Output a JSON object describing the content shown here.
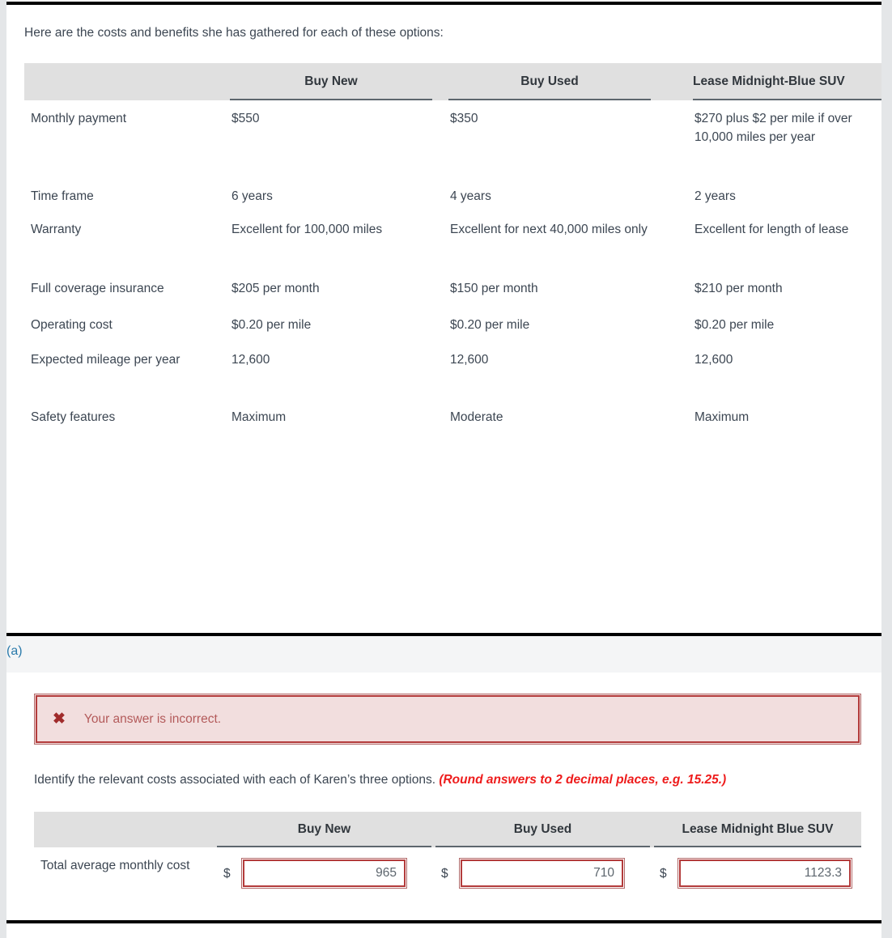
{
  "intro_text": "Here are the costs and benefits she has gathered for each of these options:",
  "comparison_table": {
    "columns": [
      "",
      "Buy New",
      "Buy Used",
      "Lease Midnight-Blue SUV"
    ],
    "rows": [
      {
        "label": "Monthly payment",
        "buy_new": "$550",
        "buy_used": "$350",
        "lease": "$270 plus $2 per mile if over\n10,000 miles per year"
      },
      {
        "label": "Time frame",
        "buy_new": "6 years",
        "buy_used": "4 years",
        "lease": "2 years"
      },
      {
        "label": "Warranty",
        "buy_new": "Excellent for 100,000 miles",
        "buy_used": "Excellent for next 40,000 miles only",
        "lease": "Excellent for length of lease"
      },
      {
        "label": "Full coverage insurance",
        "buy_new": "$205 per month",
        "buy_used": "$150 per month",
        "lease": "$210 per month"
      },
      {
        "label": "Operating cost",
        "buy_new": "$0.20 per mile",
        "buy_used": "$0.20 per mile",
        "lease": "$0.20 per mile"
      },
      {
        "label": "Expected mileage per year",
        "buy_new": "12,600",
        "buy_used": "12,600",
        "lease": "12,600"
      },
      {
        "label": "Safety features",
        "buy_new": "Maximum",
        "buy_used": "Moderate",
        "lease": "Maximum"
      }
    ]
  },
  "part": {
    "label": "(a)",
    "label_color": "#2a7aab"
  },
  "alert": {
    "icon": "x-mark-icon",
    "message": "Your answer is incorrect.",
    "background_color": "#f2dede",
    "border_color": "#b33b3b",
    "text_color": "#b35a5a"
  },
  "requirement": {
    "text": "Identify the relevant costs associated with each of Karen’s three options.",
    "hint": "(Round answers to 2 decimal places, e.g. 15.25.)",
    "hint_color": "#ee1c1c"
  },
  "answer_table": {
    "columns": [
      "",
      "Buy New",
      "Buy Used",
      "Lease Midnight Blue SUV"
    ],
    "row_label": "Total average monthly cost",
    "currency_symbol": "$",
    "inputs": [
      {
        "name": "buy-new-total",
        "value": "965",
        "placeholder": ""
      },
      {
        "name": "buy-used-total",
        "value": "710",
        "placeholder": ""
      },
      {
        "name": "lease-total",
        "value": "1123.3",
        "placeholder": ""
      }
    ],
    "input_border_color": "#b33b3b"
  }
}
